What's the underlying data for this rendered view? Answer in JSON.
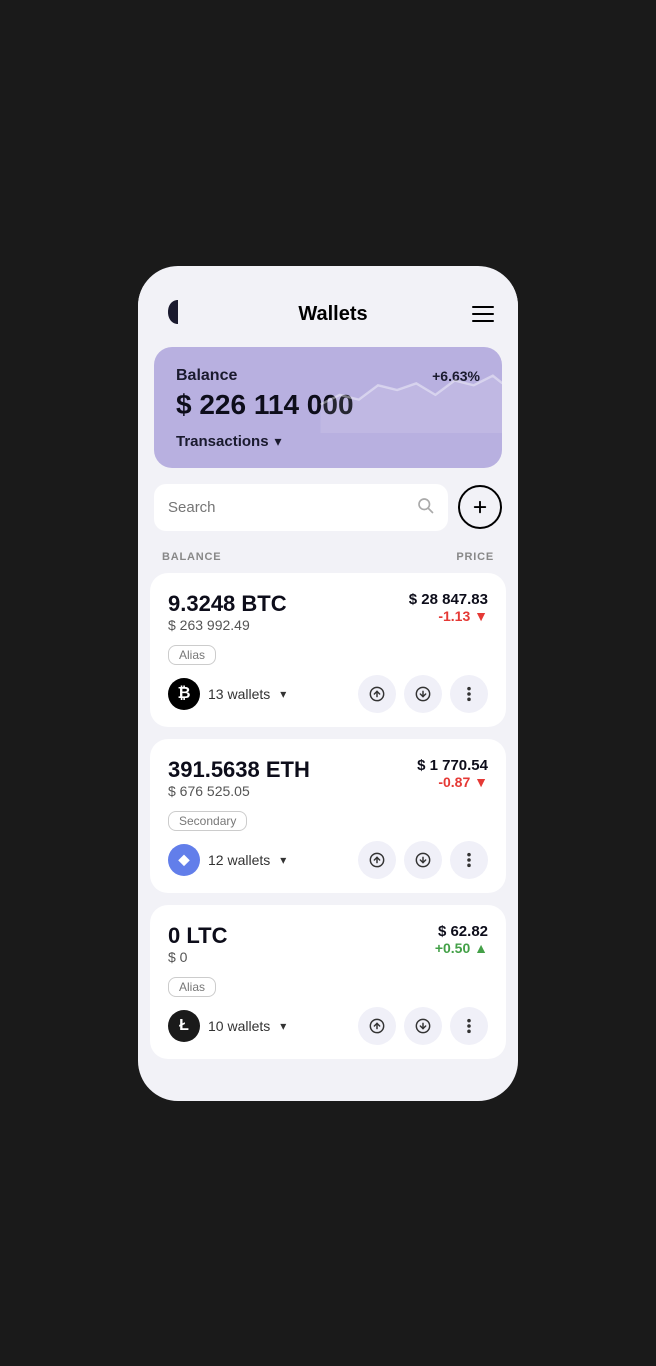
{
  "header": {
    "title": "Wallets",
    "menu_label": "menu"
  },
  "balance_card": {
    "label": "Balance",
    "change": "+6.63%",
    "amount": "$ 226 114 000",
    "transactions_label": "Transactions"
  },
  "search": {
    "placeholder": "Search"
  },
  "add_button_label": "+",
  "columns": {
    "balance": "BALANCE",
    "price": "PRICE"
  },
  "coins": [
    {
      "amount": "9.3248 BTC",
      "usd_value": "$ 263 992.49",
      "price": "$ 28 847.83",
      "change": "-1.13",
      "change_type": "neg",
      "alias": "Alias",
      "wallets": "13 wallets",
      "symbol": "₿",
      "logo_type": "btc"
    },
    {
      "amount": "391.5638 ETH",
      "usd_value": "$ 676 525.05",
      "price": "$ 1 770.54",
      "change": "-0.87",
      "change_type": "neg",
      "alias": "Secondary",
      "wallets": "12 wallets",
      "symbol": "◆",
      "logo_type": "eth"
    },
    {
      "amount": "0 LTC",
      "usd_value": "$ 0",
      "price": "$ 62.82",
      "change": "+0.50",
      "change_type": "pos",
      "alias": "Alias",
      "wallets": "10 wallets",
      "symbol": "Ł",
      "logo_type": "ltc"
    }
  ]
}
